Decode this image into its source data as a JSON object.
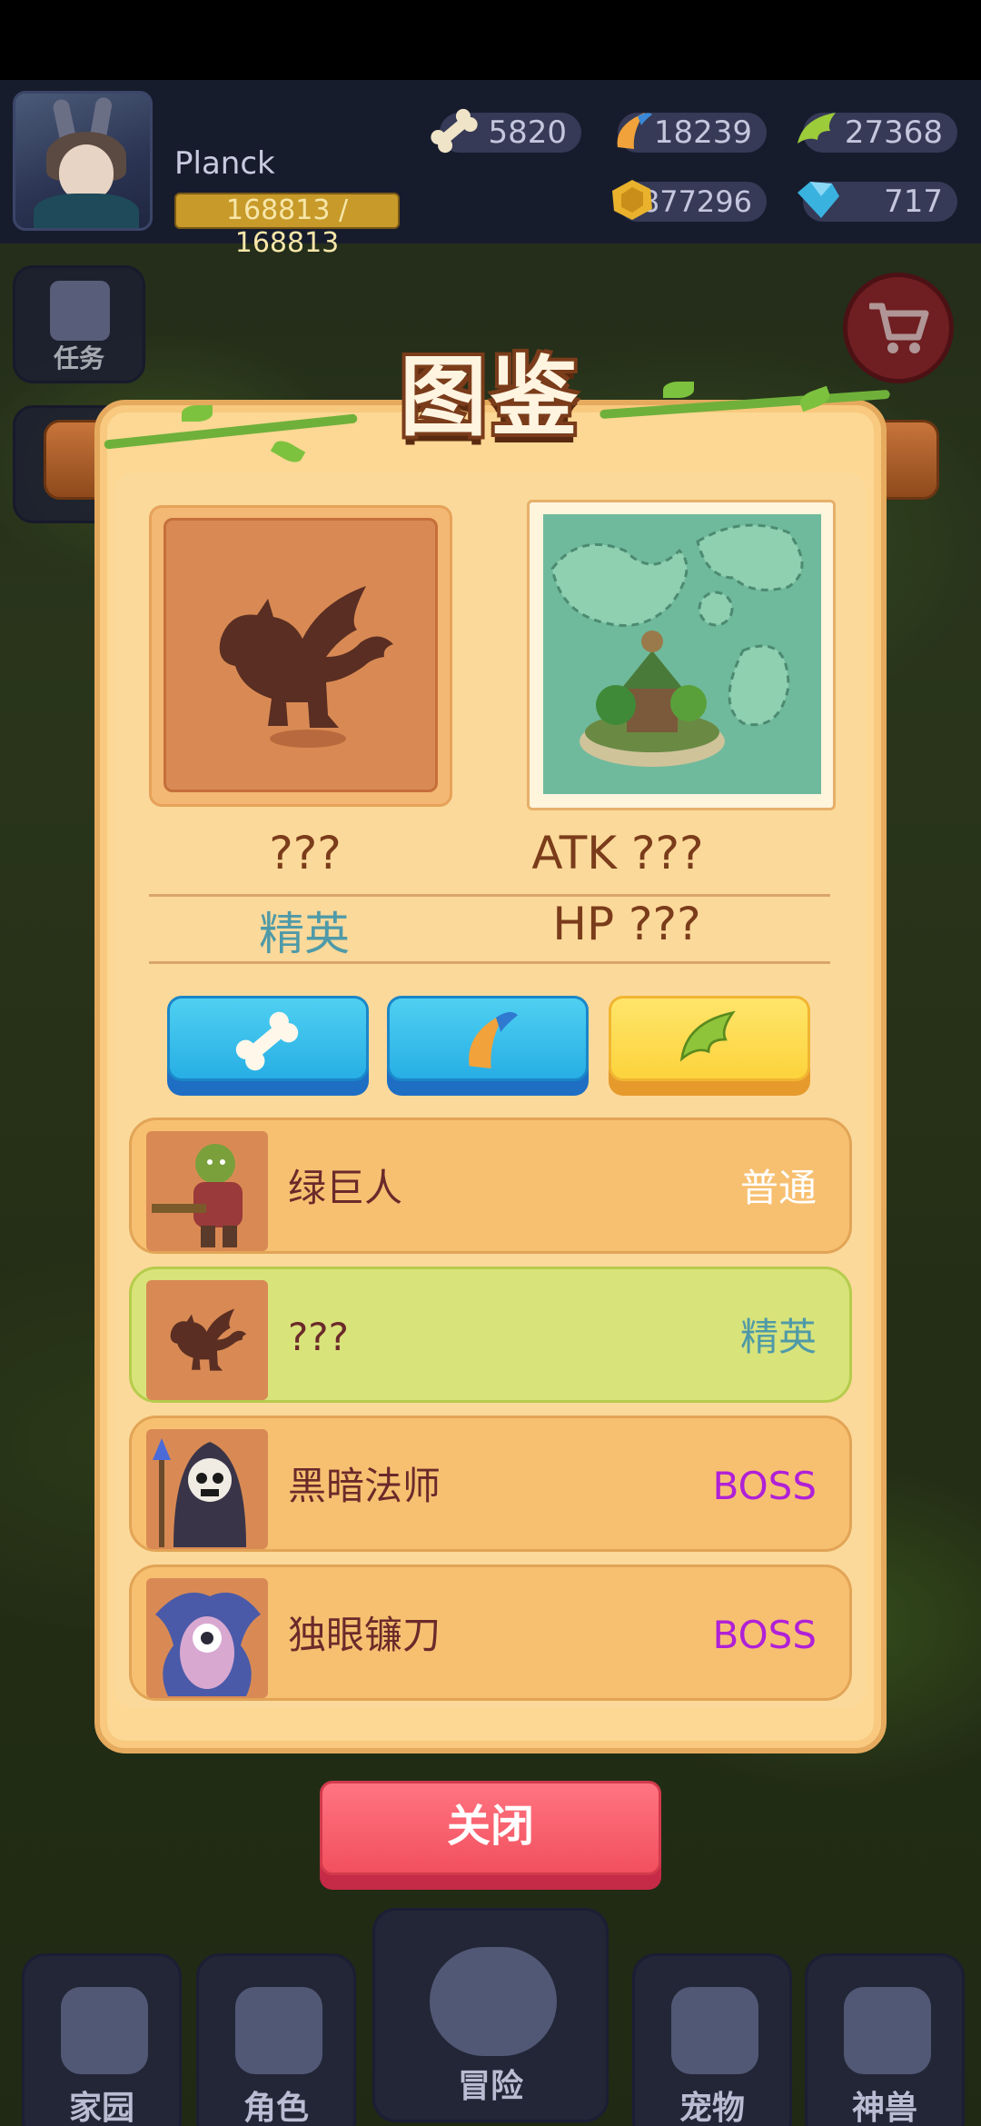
{
  "player": {
    "name": "Planck",
    "exp": "168813 / 168813"
  },
  "resources": {
    "bone": "5820",
    "horn": "18239",
    "wing": "27368",
    "gold": "4877296",
    "gem": "717"
  },
  "side_buttons": {
    "tasks": "任务"
  },
  "dialog": {
    "title": "图鉴",
    "monster_name": "???",
    "monster_rank": "精英",
    "atk": "ATK ???",
    "hp": "HP ???",
    "list": [
      {
        "name": "绿巨人",
        "type": "普通",
        "type_color": "#ffffff"
      },
      {
        "name": "???",
        "type": "精英",
        "type_color": "#4f9aa8"
      },
      {
        "name": "黑暗法师",
        "type": "BOSS",
        "type_color": "#b020d8"
      },
      {
        "name": "独眼镰刀",
        "type": "BOSS",
        "type_color": "#b020d8"
      }
    ],
    "close_label": "关闭"
  },
  "nav": {
    "home": "家园",
    "role": "角色",
    "adventure": "冒险",
    "pet": "宠物",
    "beast": "神兽"
  },
  "colors": {
    "elite": "#4f9aa8",
    "boss": "#b020d8",
    "stat": "#7a3c1a",
    "name": "#6b2a2a"
  }
}
